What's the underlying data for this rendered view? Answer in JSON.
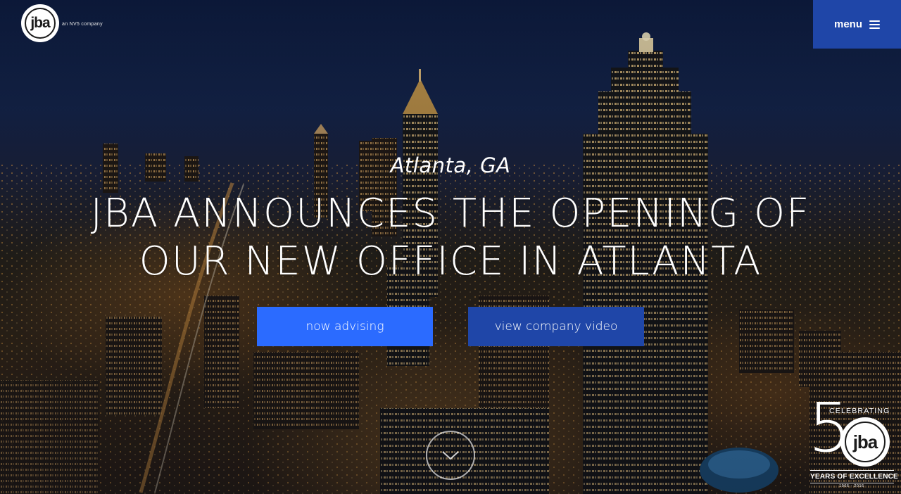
{
  "brand": {
    "logo_text": "jba",
    "tagline": "an NV5 company"
  },
  "nav": {
    "menu_label": "menu"
  },
  "hero": {
    "location": "Atlanta, GA",
    "headline_line1": "JBA ANNOUNCES THE OPENING OF",
    "headline_line2": "OUR NEW OFFICE IN ATLANTA",
    "primary_button": "now advising",
    "secondary_button": "view company video"
  },
  "anniversary": {
    "number_digit": "5",
    "celebrating": "CELEBRATING",
    "logo_text": "jba",
    "years_text": "YEARS OF EXCELLENCE",
    "dates": "1966 - 2016"
  },
  "colors": {
    "menu_bg": "#1f46a8",
    "primary_button_bg": "#2b6bff",
    "secondary_button_bg": "#1f46a8"
  },
  "icons": {
    "menu": "hamburger-icon",
    "scroll": "chevron-down-icon"
  }
}
